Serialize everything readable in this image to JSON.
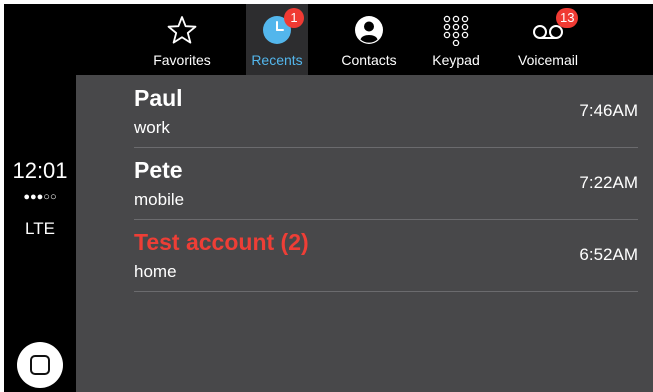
{
  "status": {
    "time": "12:01",
    "signal": "●●●○○",
    "network": "LTE"
  },
  "tabs": [
    {
      "label": "Favorites",
      "icon": "star-icon"
    },
    {
      "label": "Recents",
      "icon": "clock-icon",
      "badge": "1",
      "active": true
    },
    {
      "label": "Contacts",
      "icon": "contact-icon"
    },
    {
      "label": "Keypad",
      "icon": "keypad-icon"
    },
    {
      "label": "Voicemail",
      "icon": "voicemail-icon",
      "badge": "13"
    }
  ],
  "recents": [
    {
      "name": "Paul",
      "type": "work",
      "time": "7:46AM",
      "missed": false
    },
    {
      "name": "Pete",
      "type": "mobile",
      "time": "7:22AM",
      "missed": false
    },
    {
      "name": "Test account (2)",
      "type": "home",
      "time": "6:52AM",
      "missed": true
    }
  ],
  "colors": {
    "accent": "#53b6ec",
    "missed": "#ee3e36",
    "badge": "#f03a33",
    "list_bg": "#48484a"
  }
}
